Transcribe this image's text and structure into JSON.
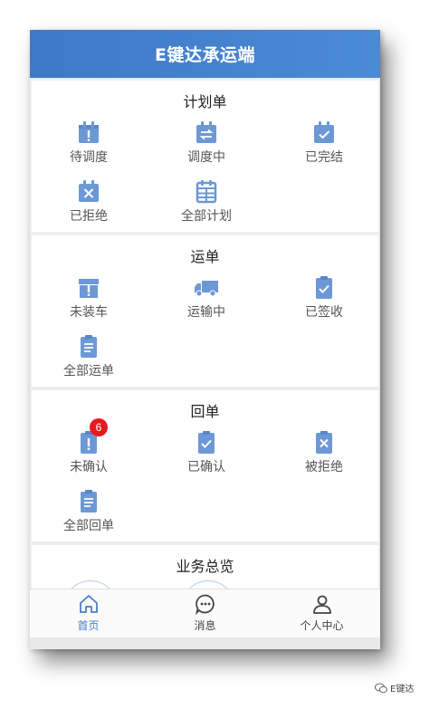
{
  "header": {
    "title": "E键达承运端"
  },
  "sections": {
    "plan": {
      "title": "计划单",
      "items": [
        {
          "label": "待调度",
          "icon": "calendar-exclamation-icon"
        },
        {
          "label": "调度中",
          "icon": "calendar-swap-icon"
        },
        {
          "label": "已完结",
          "icon": "calendar-check-icon"
        },
        {
          "label": "已拒绝",
          "icon": "calendar-x-icon"
        },
        {
          "label": "全部计划",
          "icon": "calendar-grid-icon"
        }
      ]
    },
    "waybill": {
      "title": "运单",
      "items": [
        {
          "label": "未装车",
          "icon": "box-exclamation-icon"
        },
        {
          "label": "运输中",
          "icon": "truck-icon"
        },
        {
          "label": "已签收",
          "icon": "clipboard-check-icon"
        },
        {
          "label": "全部运单",
          "icon": "clipboard-list-icon"
        }
      ]
    },
    "receipt": {
      "title": "回单",
      "items": [
        {
          "label": "未确认",
          "icon": "clipboard-exclamation-icon",
          "badge": "6"
        },
        {
          "label": "已确认",
          "icon": "clipboard-check-icon"
        },
        {
          "label": "被拒绝",
          "icon": "clipboard-x-icon"
        },
        {
          "label": "全部回单",
          "icon": "clipboard-list-icon"
        }
      ]
    },
    "overview": {
      "title": "业务总览"
    }
  },
  "tabbar": {
    "items": [
      {
        "label": "首页",
        "icon": "home-icon",
        "active": true
      },
      {
        "label": "消息",
        "icon": "message-icon",
        "active": false
      },
      {
        "label": "个人中心",
        "icon": "user-icon",
        "active": false
      }
    ]
  },
  "watermark": {
    "text": "E键达"
  },
  "colors": {
    "primary": "#4a7fc4",
    "icon": "#6d98d6",
    "badge": "#e8191e",
    "header_start": "#3f79c6",
    "header_end": "#4a8bd6"
  }
}
